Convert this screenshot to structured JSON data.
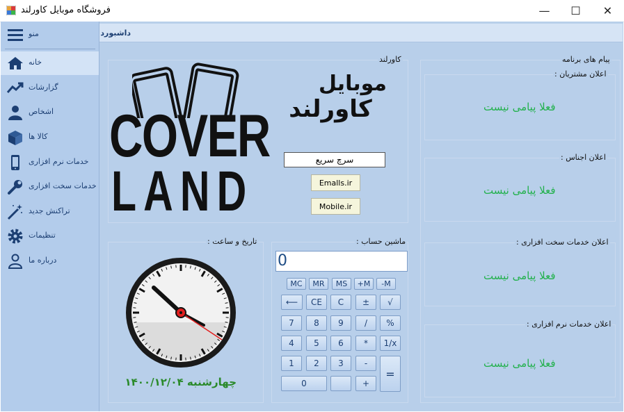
{
  "window": {
    "title": "فروشگاه موبایل کاورلند",
    "minimize": "—",
    "maximize": "☐",
    "close": "✕"
  },
  "sidebar": {
    "menu_label": "منو",
    "items": [
      {
        "label": "خانه",
        "icon": "home-icon"
      },
      {
        "label": "گزارشات",
        "icon": "trend-chart-icon"
      },
      {
        "label": "اشخاص",
        "icon": "person-icon"
      },
      {
        "label": "کالا ها",
        "icon": "box-icon"
      },
      {
        "label": "خدمات نرم افزاری",
        "icon": "mobile-phone-icon"
      },
      {
        "label": "خدمات سخت افزاری",
        "icon": "wrench-icon"
      },
      {
        "label": "تراکنش جدید",
        "icon": "magic-wand-icon"
      },
      {
        "label": "تنظیمات",
        "icon": "gear-icon"
      },
      {
        "label": "درباره ما",
        "icon": "user-outline-icon"
      }
    ]
  },
  "header": {
    "title": "داشبورد"
  },
  "coverland": {
    "group_label": "کاورلند",
    "logo_line1": "COVER",
    "logo_line2": "LAND",
    "brand_fa_line1": "موبایل",
    "brand_fa_line2": "کاورلند",
    "quick_search": "سرچ سریع",
    "link1": "Emalls.ir",
    "link2": "Mobile.ir"
  },
  "clock": {
    "group_label": "تاریخ و ساعت :",
    "date_text": "چهارشنبه  ۱۴۰۰/۱۲/۰۴"
  },
  "calculator": {
    "group_label": "ماشین حساب :",
    "display": "0",
    "memory": [
      "MC",
      "MR",
      "MS",
      "+M",
      "-M"
    ],
    "row1": [
      "⟵",
      "CE",
      "C",
      "±",
      "√"
    ],
    "row2": [
      "7",
      "8",
      "9",
      "/",
      "%"
    ],
    "row3": [
      "4",
      "5",
      "6",
      "*",
      "1/x"
    ],
    "row4": [
      "1",
      "2",
      "3",
      "-"
    ],
    "row5": [
      "0",
      "",
      "+"
    ],
    "equals": "="
  },
  "messages": {
    "group_label": "پیام های برنامه",
    "no_message": "فعلا پیامی نیست",
    "sections": [
      {
        "label": "اعلان مشتریان :"
      },
      {
        "label": "اعلان اجناس :"
      },
      {
        "label": "اعلان خدمات سخت افزاری :"
      },
      {
        "label": "اعلان خدمات نرم افزاری :"
      }
    ]
  },
  "colors": {
    "accent": "#1c3f73",
    "panel": "#b8cfea",
    "sidebar": "#b3cceb",
    "success": "#22b14c"
  }
}
